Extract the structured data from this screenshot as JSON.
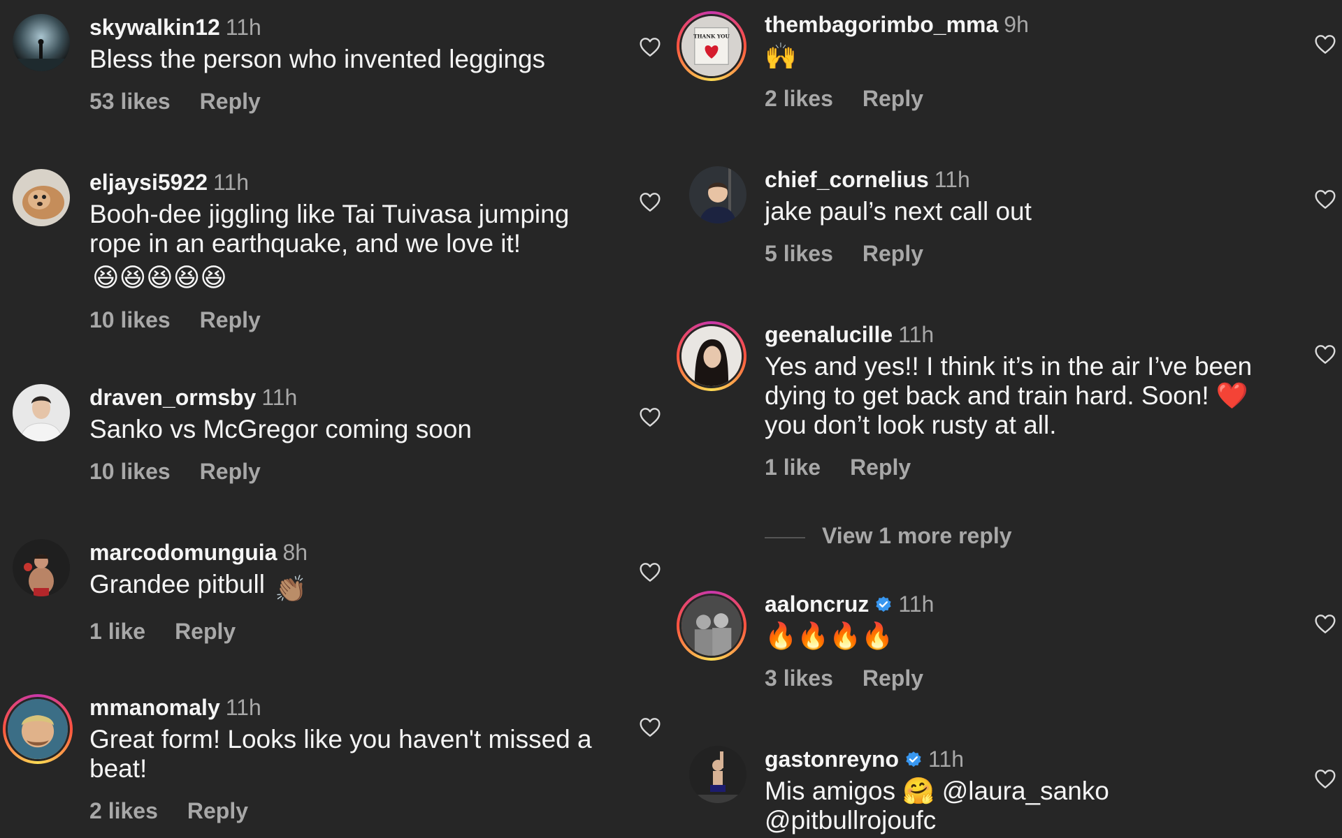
{
  "comments_left": [
    {
      "username": "skywalkin12",
      "time": "11h",
      "text": "Bless the person who invented leggings",
      "likes": "53 likes",
      "reply": "Reply"
    },
    {
      "username": "eljaysi5922",
      "time": "11h",
      "text": "Booh-dee jiggling like Tai Tuivasa jumping rope in an earthquake, and we love it!",
      "emoji": "😆😆😆😆😆",
      "likes": "10 likes",
      "reply": "Reply"
    },
    {
      "username": "draven_ormsby",
      "time": "11h",
      "text": "Sanko vs McGregor coming soon",
      "likes": "10 likes",
      "reply": "Reply"
    },
    {
      "username": "marcodomunguia",
      "time": "8h",
      "text": "Grandee pitbull",
      "emoji": "👏🏽",
      "likes": "1 like",
      "reply": "Reply"
    },
    {
      "username": "mmanomaly",
      "time": "11h",
      "text": "Great form! Looks like you haven't missed a beat!",
      "likes": "2 likes",
      "reply": "Reply"
    }
  ],
  "comments_right": [
    {
      "username": "thembagorimbo_mma",
      "time": "9h",
      "text": "🙌",
      "likes": "2 likes",
      "reply": "Reply"
    },
    {
      "username": "chief_cornelius",
      "time": "11h",
      "text": "jake paul’s next call out",
      "likes": "5 likes",
      "reply": "Reply"
    },
    {
      "username": "geenalucille",
      "time": "11h",
      "text": "Yes and yes!! I think it’s in the air I’ve been dying to get back and train hard. Soon! ❤️ you don’t look rusty at all.",
      "likes": "1 like",
      "reply": "Reply"
    },
    {
      "username": "aaloncruz",
      "time": "11h",
      "text": "🔥🔥🔥🔥",
      "likes": "3 likes",
      "reply": "Reply"
    },
    {
      "username": "gastonreyno",
      "time": "11h",
      "text": "Mis amigos 🤗 @laura_sanko @pitbullrojoufc"
    }
  ],
  "view_more_replies": "View 1 more reply",
  "icons": {
    "like": "heart-outline-icon",
    "verified": "verified-badge-icon"
  },
  "colors": {
    "background": "#262626",
    "primary_text": "#f5f5f5",
    "secondary_text": "#a8a8a8",
    "verified_blue": "#3897f0"
  },
  "avatar_labels": {
    "thank_you_sign": "THANK YOU"
  }
}
